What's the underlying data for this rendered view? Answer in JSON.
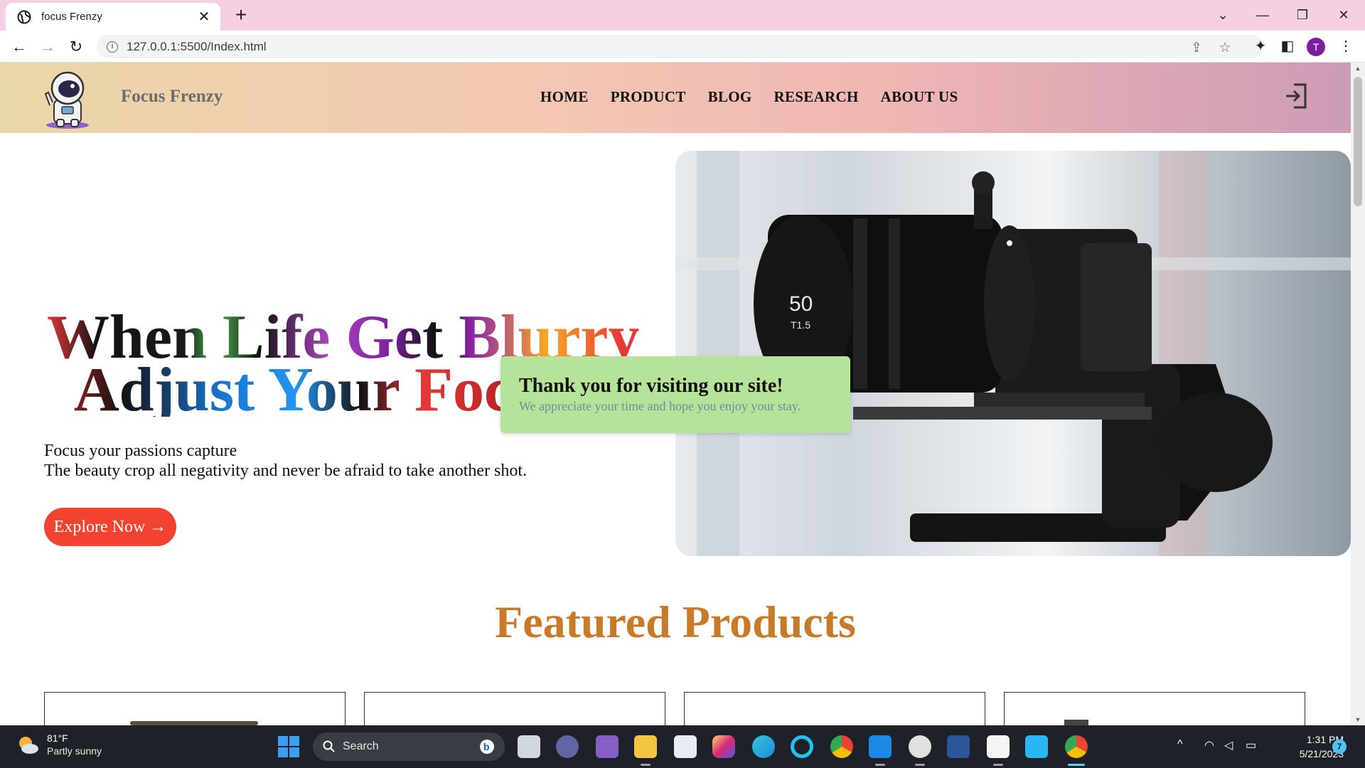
{
  "browser": {
    "tab_title": "focus Frenzy",
    "url": "127.0.0.1:5500/Index.html",
    "profile_initial": "T"
  },
  "site": {
    "brand": "Focus Frenzy",
    "nav": [
      "HOME",
      "PRODUCT",
      "BLOG",
      "RESEARCH",
      "ABOUT US"
    ],
    "headline_line1": "When Life Get Blurry",
    "headline_line2": "Adjust Your Focus",
    "tagline_line1": "Focus your passions capture",
    "tagline_line2": "The beauty crop all negativity and never be afraid to take another shot.",
    "cta_label": "Explore Now →",
    "featured_title": "Featured Products"
  },
  "toast": {
    "title": "Thank you for visiting our site!",
    "text": "We appreciate your time and hope you enjoy your stay."
  },
  "taskbar": {
    "weather_temp": "81°F",
    "weather_desc": "Partly sunny",
    "search_label": "Search",
    "time": "1:31 PM",
    "date": "5/21/2023",
    "notification_count": "7"
  },
  "colors": {
    "accent_cta": "#f1432f",
    "featured_title": "#c87a2b",
    "toast_bg": "#b6e39a"
  }
}
